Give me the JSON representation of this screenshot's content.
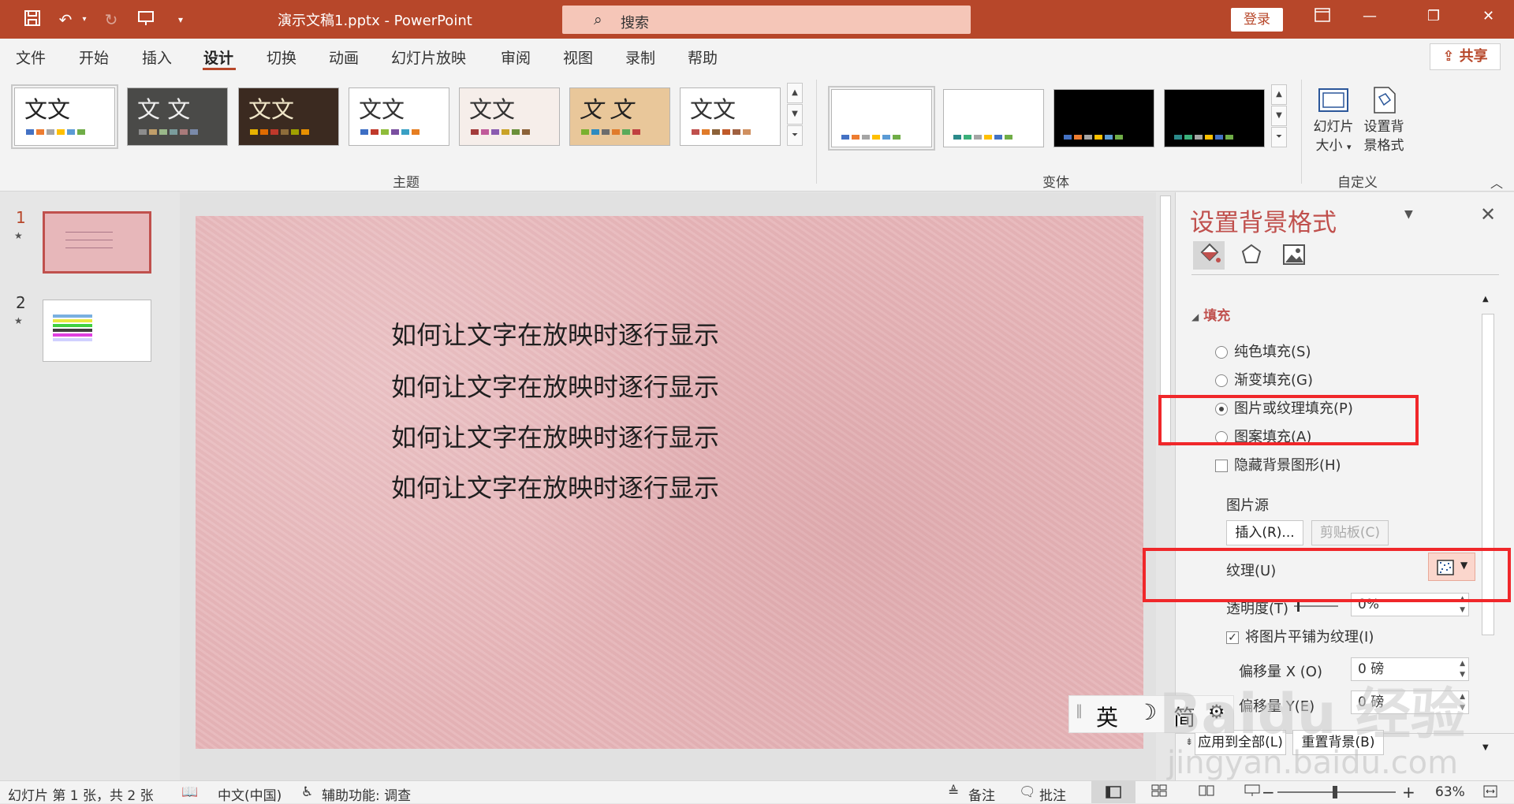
{
  "titlebar": {
    "doc_title": "演示文稿1.pptx  -  PowerPoint",
    "search_placeholder": "搜索",
    "login_label": "登录"
  },
  "tabs": [
    {
      "label": "文件"
    },
    {
      "label": "开始"
    },
    {
      "label": "插入"
    },
    {
      "label": "设计"
    },
    {
      "label": "切换"
    },
    {
      "label": "动画"
    },
    {
      "label": "幻灯片放映"
    },
    {
      "label": "审阅"
    },
    {
      "label": "视图"
    },
    {
      "label": "录制"
    },
    {
      "label": "帮助"
    }
  ],
  "active_tab": "设计",
  "share_label": "共享",
  "ribbon": {
    "themes_group_label": "主题",
    "variants_group_label": "变体",
    "customize_group_label": "自定义",
    "theme_thumb_text": "文文",
    "theme_thumb_text_alt": "文 文",
    "slide_size_label_1": "幻灯片",
    "slide_size_label_2": "大小",
    "format_bg_label_1": "设置背",
    "format_bg_label_2": "景格式"
  },
  "thumbnails": [
    {
      "number": "1",
      "star": "★"
    },
    {
      "number": "2",
      "star": "★"
    }
  ],
  "slide": {
    "lines": [
      "如何让文字在放映时逐行显示",
      "如何让文字在放映时逐行显示",
      "如何让文字在放映时逐行显示",
      "如何让文字在放映时逐行显示"
    ],
    "background_color": "#e7b7ba"
  },
  "pane": {
    "title": "设置背景格式",
    "fill_section": "填充",
    "solid_fill": "纯色填充(S)",
    "gradient_fill": "渐变填充(G)",
    "picture_fill": "图片或纹理填充(P)",
    "pattern_fill": "图案填充(A)",
    "hide_bg_graphics": "隐藏背景图形(H)",
    "picture_source": "图片源",
    "insert_button": "插入(R)...",
    "clipboard_button": "剪贴板(C)",
    "texture_label": "纹理(U)",
    "transparency_label": "透明度(T)",
    "transparency_value": "0%",
    "tile_label": "将图片平铺为纹理(I)",
    "offset_x_label": "偏移量 X (O)",
    "offset_x_value": "0 磅",
    "offset_y_label": "偏移量 Y(E)",
    "offset_y_value": "0 磅",
    "apply_all_button": "应用到全部(L)",
    "reset_bg_button": "重置背景(B)"
  },
  "ime": {
    "lang": "英",
    "moon": "☽",
    "mode": "简",
    "gear": "⚙"
  },
  "statusbar": {
    "slide_info": "幻灯片 第 1 张，共 2 张",
    "language": "中文(中国)",
    "accessibility": "辅助功能: 调查",
    "notes": "备注",
    "comments": "批注",
    "zoom": "63%",
    "minus": "−",
    "plus": "+"
  },
  "watermark": {
    "text": "Baidu 经验",
    "sub": "jingyan.baidu.com"
  },
  "colors": {
    "accent": "#b7472a",
    "pane_title": "#c0504d",
    "highlight_box": "#f0272a"
  }
}
